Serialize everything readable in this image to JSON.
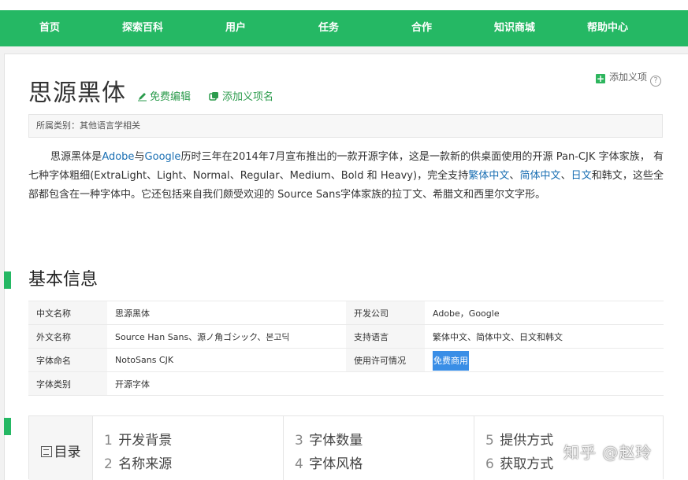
{
  "nav": {
    "items": [
      "首页",
      "探索百科",
      "用户",
      "任务",
      "合作",
      "知识商城",
      "帮助中心"
    ]
  },
  "entry": {
    "title": "思源黑体",
    "edit_label": "免费编辑",
    "add_name_label": "添加义项名",
    "add_item_label": "添加义项",
    "category_label": "所属类别：其他语言学相关"
  },
  "intro": {
    "p1": "思源黑体是",
    "link_adobe": "Adobe",
    "p2": "与",
    "link_google": "Google",
    "p3": "历时三年在2014年7月宣布推出的一款开源字体，这是一款新的供桌面使用的开源 Pan-CJK 字体家族， 有七种字体粗细(ExtraLight、Light、Normal、Regular、Medium、Bold 和 Heavy)，完全支持",
    "link_trad": "繁体中文",
    "sep1": "、",
    "link_simp": "简体中文",
    "sep2": "、",
    "link_jp": "日文",
    "p4": "和韩文，这些全部都包含在一种字体中。它还包括来自我们颇受欢迎的 Source Sans字体家族的拉丁文、希腊文和西里尔文字形。"
  },
  "basic_info": {
    "title": "基本信息",
    "rows": [
      {
        "k1": "中文名称",
        "v1": "思源黑体",
        "k2": "开发公司",
        "v2": "Adobe，Google"
      },
      {
        "k1": "外文名称",
        "v1": "Source Han Sans、源ノ角ゴシック、본고딕",
        "k2": "支持语言",
        "v2": "繁体中文、简体中文、日文和韩文"
      },
      {
        "k1": "字体命名",
        "v1": "NotoSans CJK",
        "k2": "使用许可情况",
        "v2": "免费商用"
      },
      {
        "k1": "字体类别",
        "v1": "开源字体",
        "k2": "",
        "v2": ""
      }
    ]
  },
  "toc": {
    "title": "目录",
    "items": [
      {
        "num": "1",
        "label": "开发背景"
      },
      {
        "num": "2",
        "label": "名称来源"
      },
      {
        "num": "3",
        "label": "字体数量"
      },
      {
        "num": "4",
        "label": "字体风格"
      },
      {
        "num": "5",
        "label": "提供方式"
      },
      {
        "num": "6",
        "label": "获取方式"
      }
    ]
  },
  "watermark": "知乎 @赵玲",
  "colors": {
    "brand_green": "#25b864",
    "link_blue": "#1a6fb3",
    "highlight": "#3a8ee6"
  }
}
